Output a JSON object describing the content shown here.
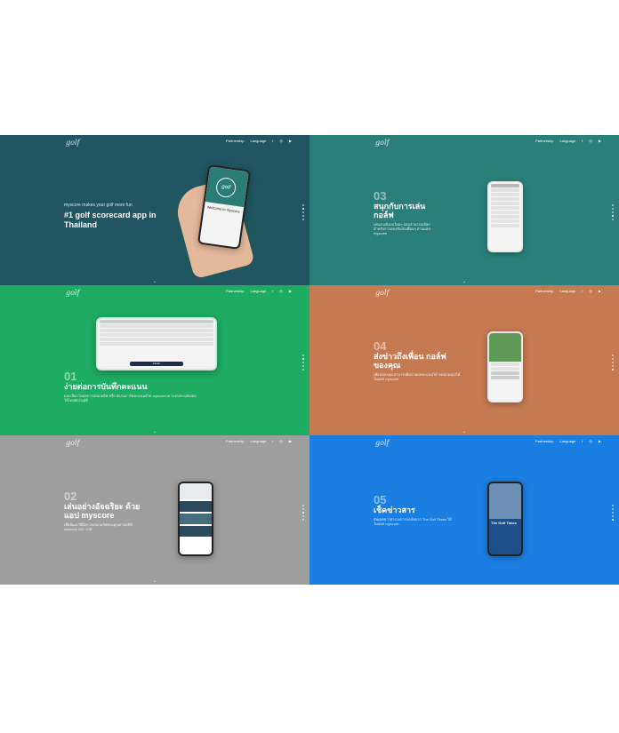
{
  "nav": {
    "partnership": "Partnership",
    "language": "Language"
  },
  "logo": "golf",
  "panels": {
    "p1": {
      "small": "myscore makes your golf more fun",
      "title": "#1 golf scorecard app in Thailand",
      "phone_logo": "golf",
      "phone_text": "Welcome to myscore"
    },
    "p2": {
      "num": "03",
      "title": "สนุกกับการเล่นกอล์ฟ",
      "desc": "เล่นเกมส์แบบใหม่ๆ ผสมสามารถเลือกสำหรับการแข่งขันกับเพื่อนๆ ผ่านแอป myscore"
    },
    "p3": {
      "num": "01",
      "title": "ง่ายต่อการบันทึกคะแนน",
      "desc": "และเลือกโหมดการเล่นกอล์ฟ หรือ สแกนการ์ดคะแนนด้วย myscore AI ระบบจะแสดงผลให้โดยอัตโนมัติ",
      "button": "Finish"
    },
    "p4": {
      "num": "04",
      "title": "ส่งข่าวถึงเพื่อน กอล์ฟ ของคุณ",
      "desc": "เพื่อนของคุณสามารถติดตามผลคะแนนได้ ของเกมคุณได้ในแอป myscore"
    },
    "p5": {
      "num": "02",
      "title": "เล่นอย่างอัจฉริยะ ด้วย แอป myscore",
      "desc": "เพื่อพัฒนาฝีมือการเล่นกอล์ฟของคุณผ่านสถิติ myscore และ GIR"
    },
    "p6": {
      "num": "05",
      "title": "เช็คข่าวสาร",
      "desc": "อัพเดตข่าวสารวงการกอล์ฟจาก The Golf Times ได้ในแอป myscore",
      "phone_title": "The Golf Times"
    }
  }
}
